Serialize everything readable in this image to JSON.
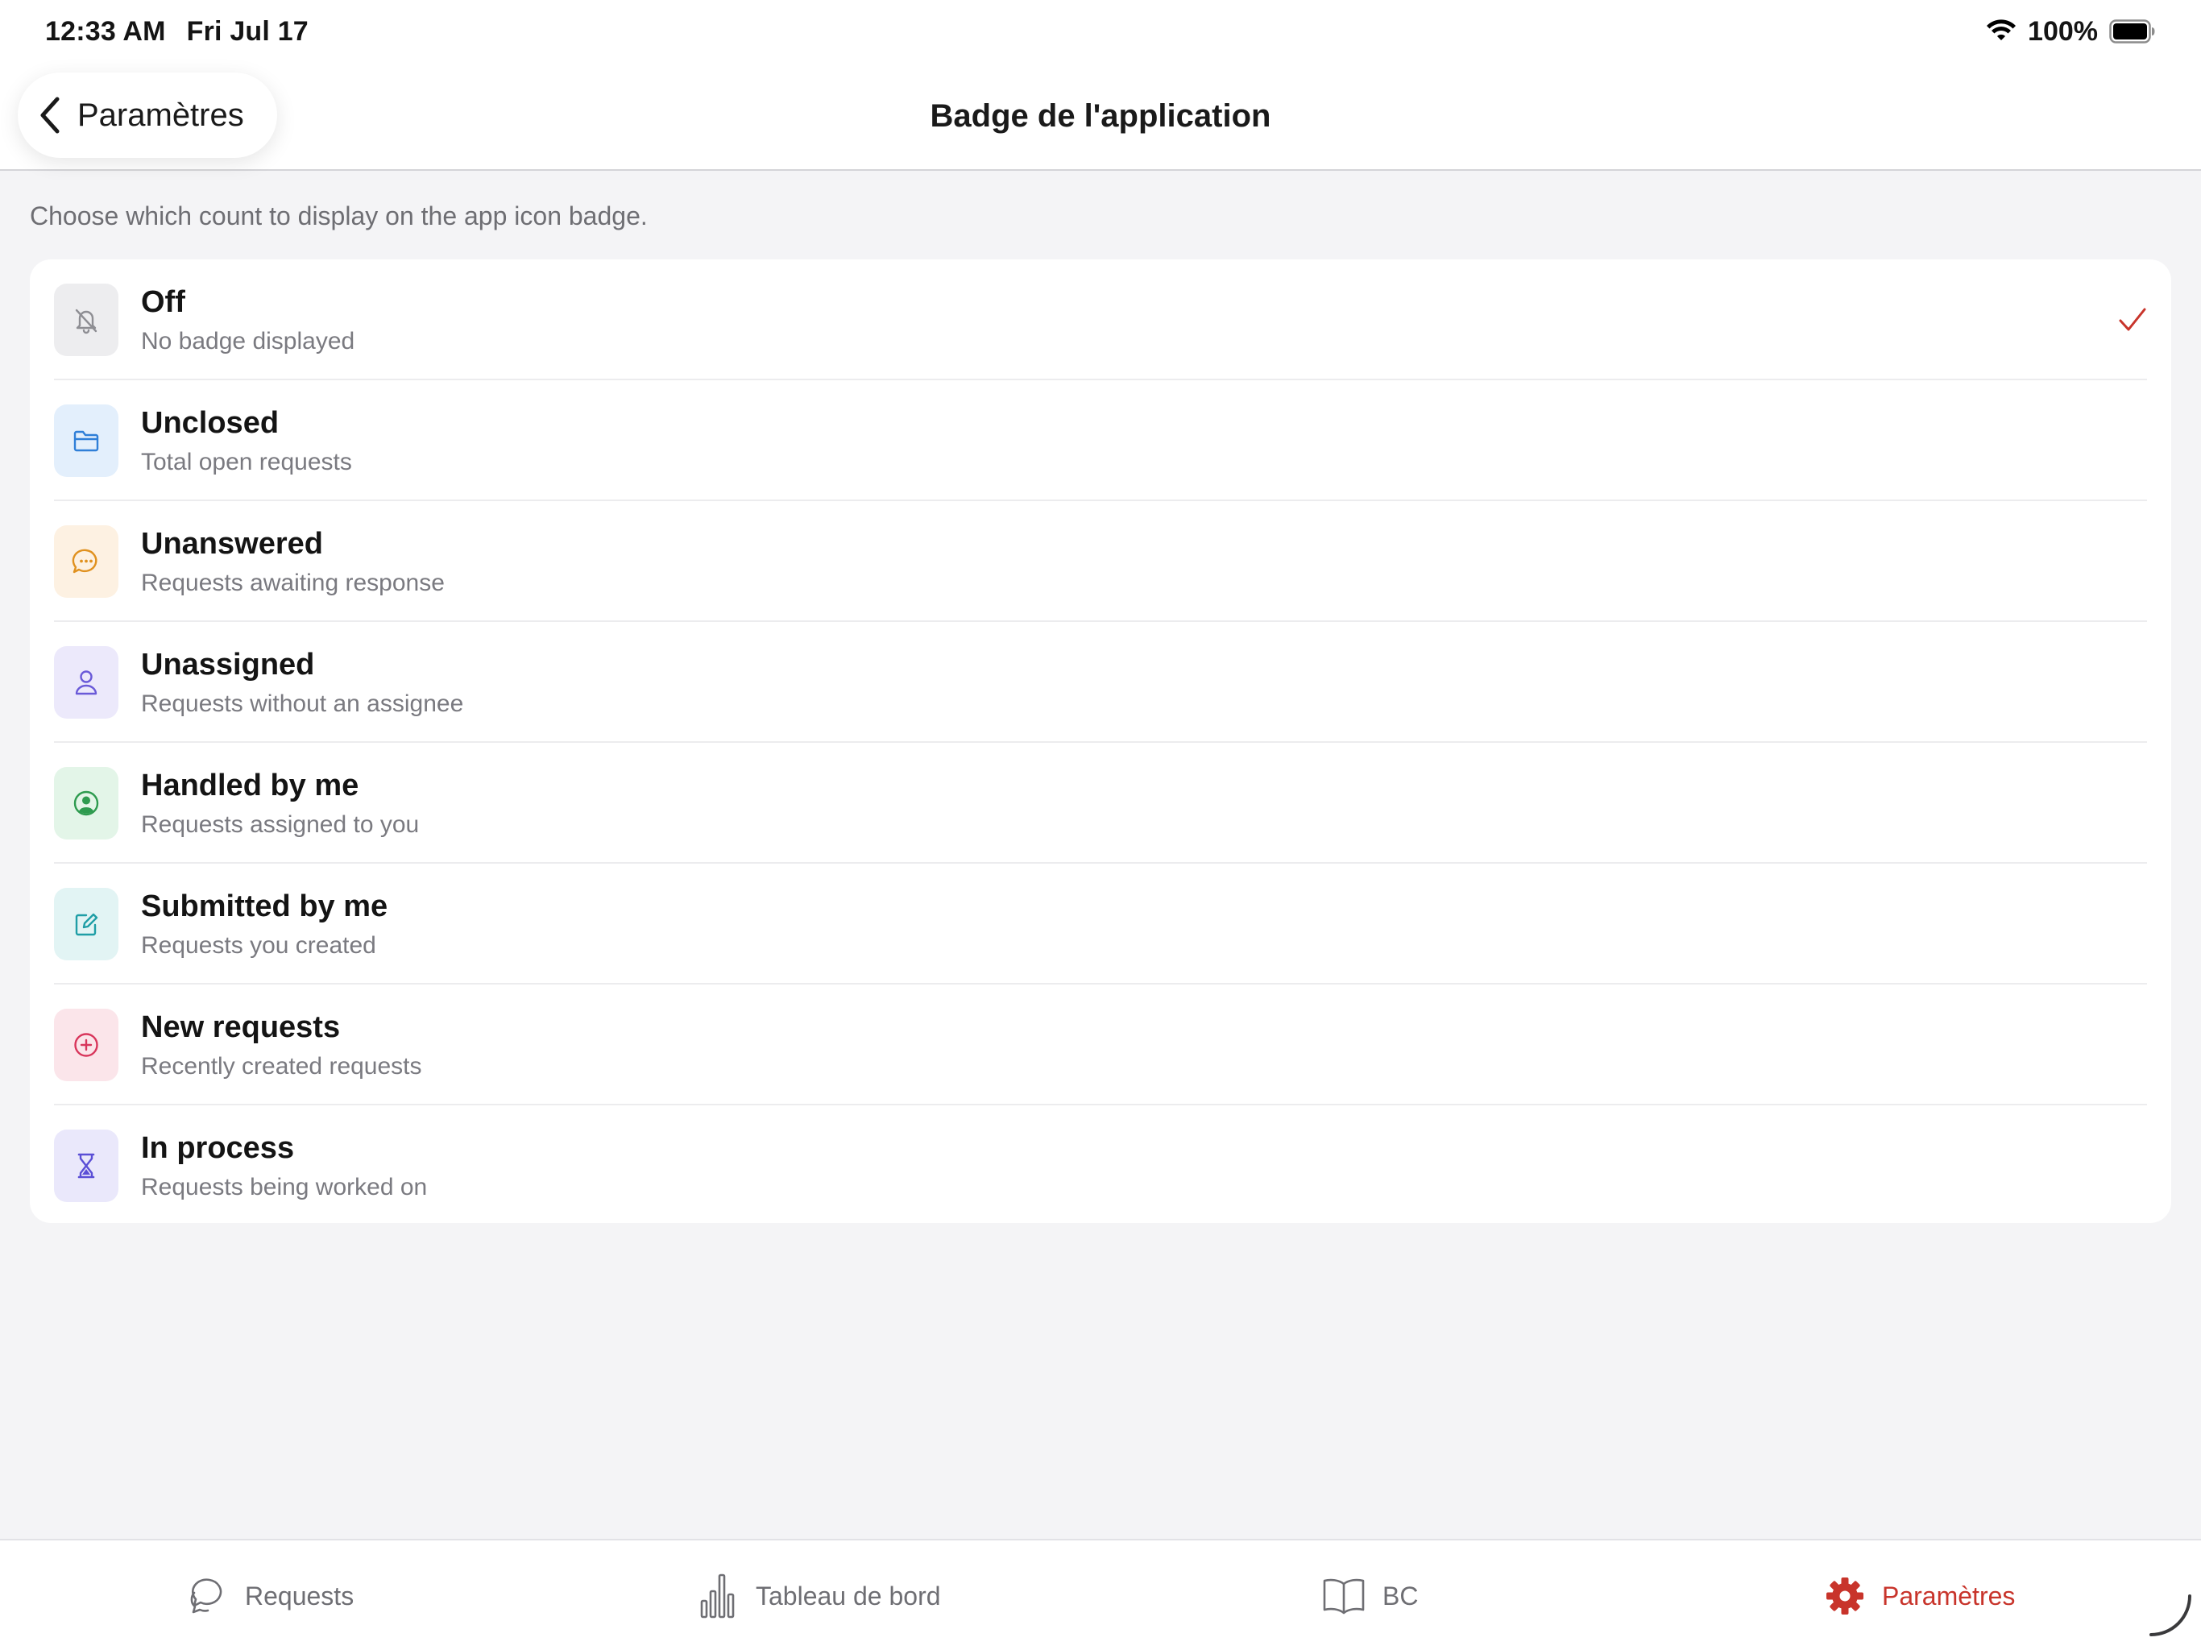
{
  "status_bar": {
    "time": "12:33 AM",
    "date": "Fri Jul 17",
    "battery": "100%"
  },
  "nav": {
    "back_label": "Paramètres",
    "title": "Badge de l'application"
  },
  "description": "Choose which count to display on the app icon badge.",
  "options": [
    {
      "title": "Off",
      "subtitle": "No badge displayed",
      "icon": "bell-off-icon",
      "selected": true
    },
    {
      "title": "Unclosed",
      "subtitle": "Total open requests",
      "icon": "folder-icon",
      "selected": false
    },
    {
      "title": "Unanswered",
      "subtitle": "Requests awaiting response",
      "icon": "chat-bubble-icon",
      "selected": false
    },
    {
      "title": "Unassigned",
      "subtitle": "Requests without an assignee",
      "icon": "person-icon",
      "selected": false
    },
    {
      "title": "Handled by me",
      "subtitle": "Requests assigned to you",
      "icon": "person-circle-icon",
      "selected": false
    },
    {
      "title": "Submitted by me",
      "subtitle": "Requests you created",
      "icon": "edit-square-icon",
      "selected": false
    },
    {
      "title": "New requests",
      "subtitle": "Recently created requests",
      "icon": "plus-circle-icon",
      "selected": false
    },
    {
      "title": "In process",
      "subtitle": "Requests being worked on",
      "icon": "hourglass-icon",
      "selected": false
    }
  ],
  "tabs": [
    {
      "label": "Requests",
      "icon": "chat-bubbles-icon",
      "active": false
    },
    {
      "label": "Tableau de bord",
      "icon": "bar-chart-icon",
      "active": false
    },
    {
      "label": "BC",
      "icon": "book-icon",
      "active": false
    },
    {
      "label": "Paramètres",
      "icon": "gear-icon",
      "active": true
    }
  ],
  "colors": {
    "accent": "#c8342b",
    "off_tile": "#ededef",
    "unclosed_tile": "#e3effc",
    "unanswered_tile": "#fdf1e2",
    "unassigned_tile": "#ece9fb",
    "handled_tile": "#e3f5e8",
    "submitted_tile": "#e2f4f4",
    "new_tile": "#fbe5ea",
    "inprocess_tile": "#eae8fb"
  }
}
